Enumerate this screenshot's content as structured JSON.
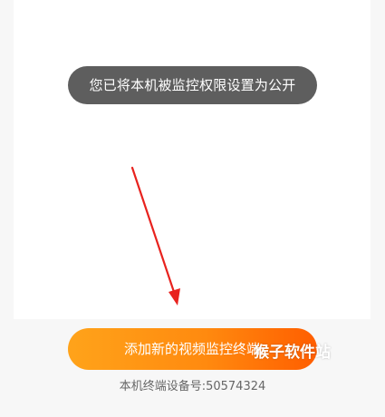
{
  "toast": {
    "message": "您已将本机被监控权限设置为公开"
  },
  "main": {
    "add_button_label": "添加新的视频监控终端",
    "device_id_text": "本机终端设备号:50574324"
  },
  "watermark": {
    "text": "猴子软件站"
  },
  "colors": {
    "toast_bg": "#5e5e5e",
    "button_gradient_start": "#ffa31a",
    "button_gradient_end": "#ff5e00",
    "arrow": "#e8221e",
    "page_bg": "#f7f7f7"
  }
}
